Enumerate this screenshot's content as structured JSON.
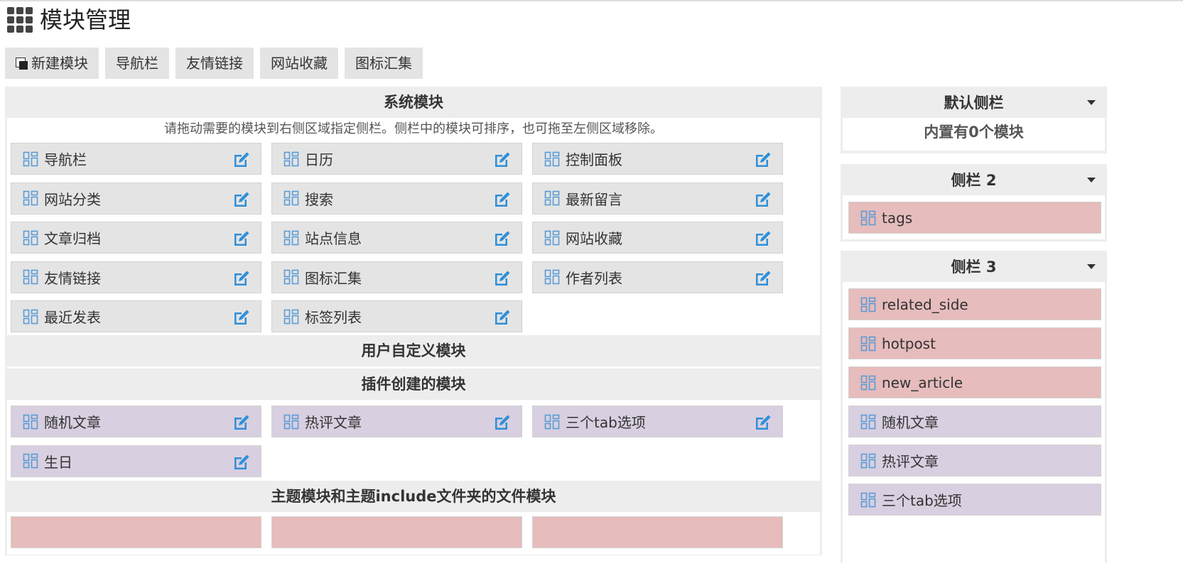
{
  "page": {
    "title": "模块管理"
  },
  "toolbar": {
    "tabs": [
      {
        "label": "新建模块"
      },
      {
        "label": "导航栏"
      },
      {
        "label": "友情链接"
      },
      {
        "label": "网站收藏"
      },
      {
        "label": "图标汇集"
      }
    ]
  },
  "system": {
    "title": "系统模块",
    "hint": "请拖动需要的模块到右侧区域指定侧栏。侧栏中的模块可排序，也可拖至左侧区域移除。",
    "modules": [
      "导航栏",
      "日历",
      "控制面板",
      "网站分类",
      "搜索",
      "最新留言",
      "文章归档",
      "站点信息",
      "网站收藏",
      "友情链接",
      "图标汇集",
      "作者列表",
      "最近发表",
      "标签列表"
    ]
  },
  "custom": {
    "title": "用户自定义模块"
  },
  "plugin": {
    "title": "插件创建的模块",
    "modules": [
      "随机文章",
      "热评文章",
      "三个tab选项",
      "生日"
    ]
  },
  "theme": {
    "title": "主题模块和主题include文件夹的文件模块"
  },
  "sidebars": {
    "default": {
      "title": "默认侧栏",
      "empty_text": "内置有0个模块"
    },
    "s2": {
      "title": "侧栏 2",
      "modules": [
        "tags"
      ]
    },
    "s3": {
      "title": "侧栏 3",
      "modules": [
        "related_side",
        "hotpost",
        "new_article",
        "随机文章",
        "热评文章",
        "三个tab选项"
      ]
    }
  },
  "colors": {
    "system_module": "#e4e4e4",
    "plugin_module": "#d8cfe0",
    "theme_module": "#e6bcbc",
    "icon_blue": "#5b9bd5"
  }
}
